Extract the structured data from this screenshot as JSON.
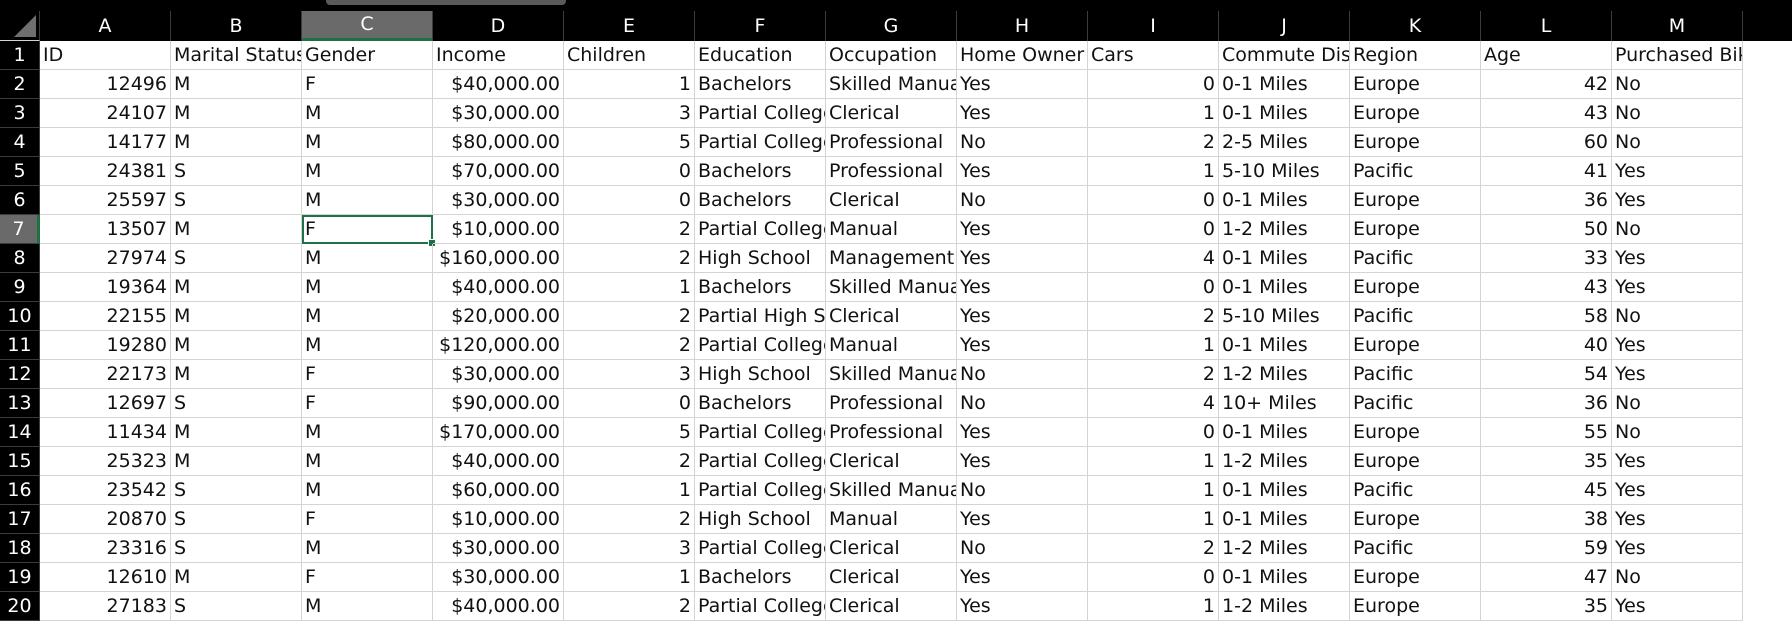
{
  "sheet": {
    "column_letters": [
      "A",
      "B",
      "C",
      "D",
      "E",
      "F",
      "G",
      "H",
      "I",
      "J",
      "K",
      "L",
      "M"
    ],
    "selected_column": "C",
    "selected_row": 7,
    "header_row": [
      "ID",
      "Marital Status",
      "Gender",
      "Income",
      "Children",
      "Education",
      "Occupation",
      "Home Owner",
      "Cars",
      "Commute Distance",
      "Region",
      "Age",
      "Purchased Bike"
    ],
    "rows": [
      [
        "12496",
        "M",
        "F",
        "$40,000.00",
        "1",
        "Bachelors",
        "Skilled Manual",
        "Yes",
        "0",
        "0-1 Miles",
        "Europe",
        "42",
        "No"
      ],
      [
        "24107",
        "M",
        "M",
        "$30,000.00",
        "3",
        "Partial College",
        "Clerical",
        "Yes",
        "1",
        "0-1 Miles",
        "Europe",
        "43",
        "No"
      ],
      [
        "14177",
        "M",
        "M",
        "$80,000.00",
        "5",
        "Partial College",
        "Professional",
        "No",
        "2",
        "2-5 Miles",
        "Europe",
        "60",
        "No"
      ],
      [
        "24381",
        "S",
        "M",
        "$70,000.00",
        "0",
        "Bachelors",
        "Professional",
        "Yes",
        "1",
        "5-10 Miles",
        "Pacific",
        "41",
        "Yes"
      ],
      [
        "25597",
        "S",
        "M",
        "$30,000.00",
        "0",
        "Bachelors",
        "Clerical",
        "No",
        "0",
        "0-1 Miles",
        "Europe",
        "36",
        "Yes"
      ],
      [
        "13507",
        "M",
        "F",
        "$10,000.00",
        "2",
        "Partial College",
        "Manual",
        "Yes",
        "0",
        "1-2 Miles",
        "Europe",
        "50",
        "No"
      ],
      [
        "27974",
        "S",
        "M",
        "$160,000.00",
        "2",
        "High School",
        "Management",
        "Yes",
        "4",
        "0-1 Miles",
        "Pacific",
        "33",
        "Yes"
      ],
      [
        "19364",
        "M",
        "M",
        "$40,000.00",
        "1",
        "Bachelors",
        "Skilled Manual",
        "Yes",
        "0",
        "0-1 Miles",
        "Europe",
        "43",
        "Yes"
      ],
      [
        "22155",
        "M",
        "M",
        "$20,000.00",
        "2",
        "Partial High School",
        "Clerical",
        "Yes",
        "2",
        "5-10 Miles",
        "Pacific",
        "58",
        "No"
      ],
      [
        "19280",
        "M",
        "M",
        "$120,000.00",
        "2",
        "Partial College",
        "Manual",
        "Yes",
        "1",
        "0-1 Miles",
        "Europe",
        "40",
        "Yes"
      ],
      [
        "22173",
        "M",
        "F",
        "$30,000.00",
        "3",
        "High School",
        "Skilled Manual",
        "No",
        "2",
        "1-2 Miles",
        "Pacific",
        "54",
        "Yes"
      ],
      [
        "12697",
        "S",
        "F",
        "$90,000.00",
        "0",
        "Bachelors",
        "Professional",
        "No",
        "4",
        "10+ Miles",
        "Pacific",
        "36",
        "No"
      ],
      [
        "11434",
        "M",
        "M",
        "$170,000.00",
        "5",
        "Partial College",
        "Professional",
        "Yes",
        "0",
        "0-1 Miles",
        "Europe",
        "55",
        "No"
      ],
      [
        "25323",
        "M",
        "M",
        "$40,000.00",
        "2",
        "Partial College",
        "Clerical",
        "Yes",
        "1",
        "1-2 Miles",
        "Europe",
        "35",
        "Yes"
      ],
      [
        "23542",
        "S",
        "M",
        "$60,000.00",
        "1",
        "Partial College",
        "Skilled Manual",
        "No",
        "1",
        "0-1 Miles",
        "Pacific",
        "45",
        "Yes"
      ],
      [
        "20870",
        "S",
        "F",
        "$10,000.00",
        "2",
        "High School",
        "Manual",
        "Yes",
        "1",
        "0-1 Miles",
        "Europe",
        "38",
        "Yes"
      ],
      [
        "23316",
        "S",
        "M",
        "$30,000.00",
        "3",
        "Partial College",
        "Clerical",
        "No",
        "2",
        "1-2 Miles",
        "Pacific",
        "59",
        "Yes"
      ],
      [
        "12610",
        "M",
        "F",
        "$30,000.00",
        "1",
        "Bachelors",
        "Clerical",
        "Yes",
        "0",
        "0-1 Miles",
        "Europe",
        "47",
        "No"
      ],
      [
        "27183",
        "S",
        "M",
        "$40,000.00",
        "2",
        "Partial College",
        "Clerical",
        "Yes",
        "1",
        "1-2 Miles",
        "Europe",
        "35",
        "Yes"
      ]
    ],
    "numeric_columns": [
      0,
      3,
      4,
      8,
      11
    ],
    "colors": {
      "selection": "#1e7145",
      "header_bg": "#000000",
      "header_text": "#ffffff",
      "gridline": "#d4d4d4"
    }
  }
}
